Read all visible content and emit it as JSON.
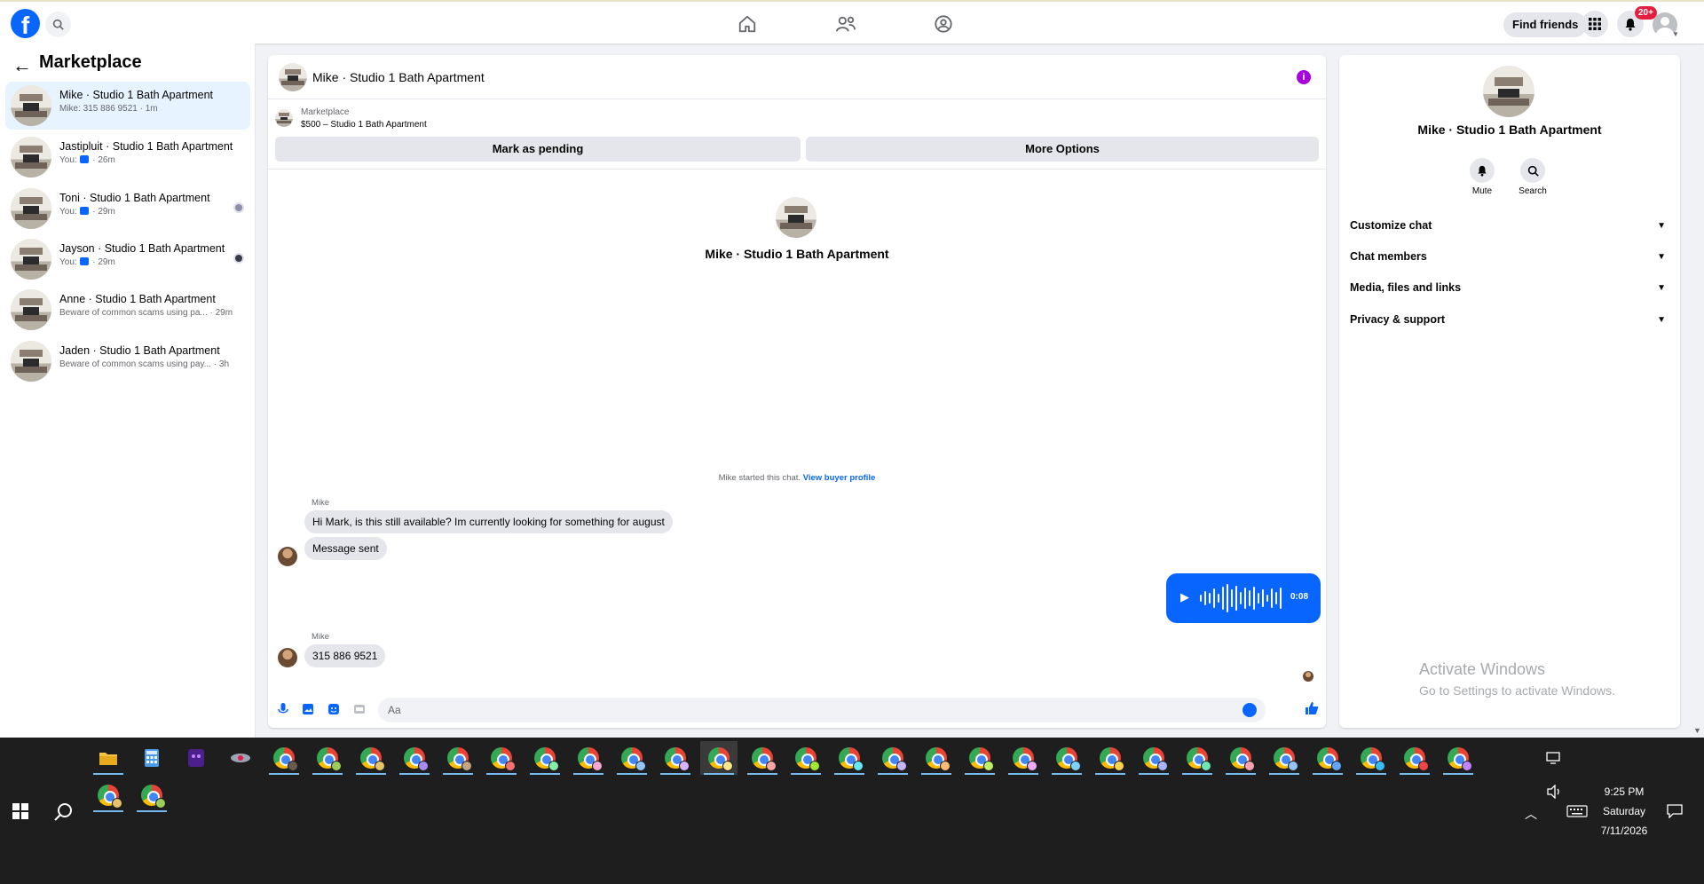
{
  "topbar": {
    "logo": "f",
    "find_friends": "Find friends",
    "notifications_badge": "20+",
    "icons": [
      "search-icon",
      "home-icon",
      "friends-icon",
      "groups-icon",
      "apps-grid-icon",
      "bell-icon",
      "avatar"
    ]
  },
  "sidebar": {
    "title": "Marketplace",
    "conversations": [
      {
        "title": "Mike · Studio 1 Bath Apartment",
        "subtitle": "Mike: 315 886 9521 · 1m",
        "active": true
      },
      {
        "title": "Jastipluit · Studio 1 Bath Apartment",
        "subtitle_prefix": "You:",
        "subtitle_suffix": "· 26m"
      },
      {
        "title": "Toni · Studio 1 Bath Apartment",
        "subtitle_prefix": "You:",
        "subtitle_suffix": "· 29m"
      },
      {
        "title": "Jayson · Studio 1 Bath Apartment",
        "subtitle_prefix": "You:",
        "subtitle_suffix": "· 29m"
      },
      {
        "title": "Anne · Studio 1 Bath Apartment",
        "subtitle": "Beware of common scams using pa... · 29m"
      },
      {
        "title": "Jaden · Studio 1 Bath Apartment",
        "subtitle": "Beware of common scams using pay... · 3h"
      }
    ]
  },
  "chat": {
    "header_title": "Mike · Studio 1 Bath Apartment",
    "marketplace_label": "Marketplace",
    "listing": "$500 – Studio 1 Bath Apartment",
    "mark_pending": "Mark as pending",
    "more_options": "More Options",
    "profile_name": "Mike · Studio 1 Bath Apartment",
    "started_text": "Mike started this chat.",
    "view_buyer_profile": "View buyer profile",
    "sender_1": "Mike",
    "message_1": "Hi Mark, is this still available? Im currently looking for something for august",
    "message_2": "Message sent",
    "voice_duration": "0:08",
    "sender_2": "Mike",
    "message_3": "315 886 9521",
    "composer_placeholder": "Aa",
    "accent": "#0866ff"
  },
  "right_panel": {
    "name": "Mike · Studio 1 Bath Apartment",
    "mute": "Mute",
    "search": "Search",
    "sections": [
      "Customize chat",
      "Chat members",
      "Media, files and links",
      "Privacy & support"
    ],
    "watermark_title": "Activate Windows",
    "watermark_sub": "Go to Settings to activate Windows."
  },
  "taskbar": {
    "time": "9:25 PM",
    "day": "Saturday",
    "date": "7/11/2026"
  }
}
